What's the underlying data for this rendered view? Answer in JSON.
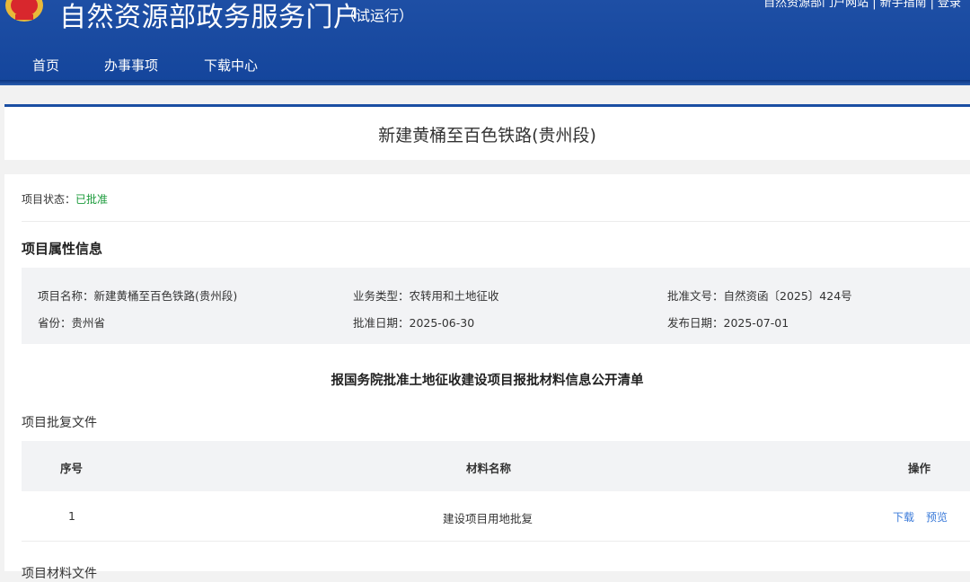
{
  "header": {
    "site_title": "自然资源部政务服务门户",
    "trial": "（试运行）",
    "top_links": [
      "自然资源部门户网站",
      "新手指南",
      "登录"
    ]
  },
  "nav": {
    "items": [
      "首页",
      "办事事项",
      "下载中心"
    ]
  },
  "project": {
    "title": "新建黄桶至百色铁路(贵州段)"
  },
  "status": {
    "label": "项目状态：",
    "value": "已批准"
  },
  "attributes": {
    "section_title": "项目属性信息",
    "name": "项目名称：新建黄桶至百色铁路(贵州段)",
    "type": "业务类型：农转用和土地征收",
    "doc_no": "批准文号：自然资函〔2025〕424号",
    "province": "省份：贵州省",
    "approve_date": "批准日期：2025-06-30",
    "publish_date": "发布日期：2025-07-01"
  },
  "materials": {
    "list_title": "报国务院批准土地征收建设项目报批材料信息公开清单",
    "sub_title": "项目批复文件",
    "columns": {
      "index": "序号",
      "name": "材料名称",
      "action": "操作"
    },
    "rows": [
      {
        "index": "1",
        "name": "建设项目用地批复",
        "download": "下载",
        "preview": "预览"
      }
    ],
    "next_title": "项目材料文件"
  },
  "colors": {
    "brand_blue": "#1a4ea3",
    "status_green": "#1a9a3a",
    "link_blue": "#3a7ad9"
  }
}
